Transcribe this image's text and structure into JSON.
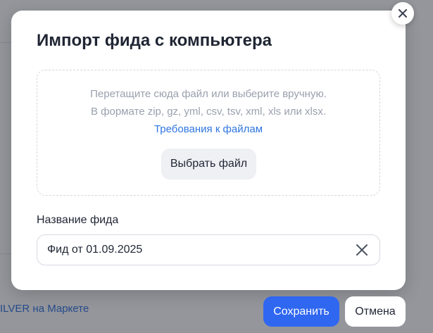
{
  "background": {
    "link_text": "ILVER на Маркете"
  },
  "modal": {
    "title": "Импорт фида с компьютера",
    "dropzone": {
      "hint_line1": "Перетащите сюда файл или выберите вручную.",
      "hint_line2": "В формате zip, gz, yml, csv, tsv, xml, xls или xlsx.",
      "requirements_link": "Требования к файлам",
      "choose_button": "Выбрать файл"
    },
    "feed_name": {
      "label": "Название фида",
      "value": "Фид от 01.09.2025"
    }
  },
  "actions": {
    "save_label": "Сохранить",
    "cancel_label": "Отмена"
  },
  "icons": {
    "close": "close-icon",
    "clear": "clear-icon"
  },
  "colors": {
    "primary": "#2f67f0",
    "link": "#2f76e0",
    "overlay": "rgba(32,36,46,0.48)"
  }
}
